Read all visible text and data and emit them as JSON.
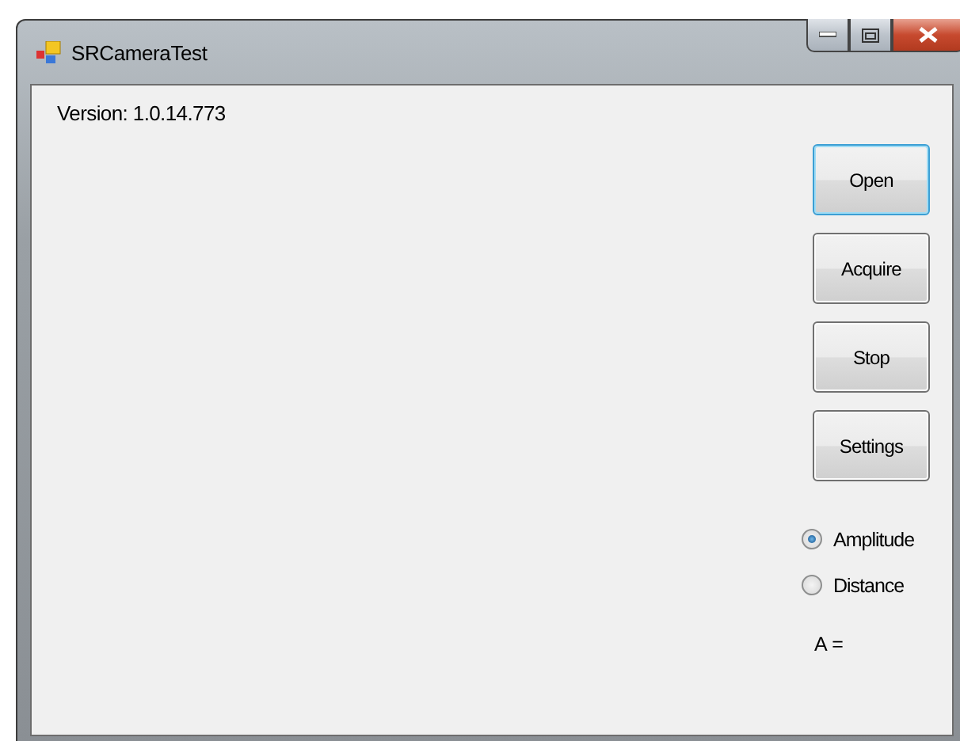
{
  "window": {
    "title": "SRCameraTest"
  },
  "version_label": "Version: 1.0.14.773",
  "buttons": [
    {
      "label": "Open",
      "focused": true
    },
    {
      "label": "Acquire",
      "focused": false
    },
    {
      "label": "Stop",
      "focused": false
    },
    {
      "label": "Settings",
      "focused": false
    }
  ],
  "mode_options": [
    {
      "label": "Amplitude",
      "selected": true
    },
    {
      "label": "Distance",
      "selected": false
    }
  ],
  "value_label": "A ="
}
